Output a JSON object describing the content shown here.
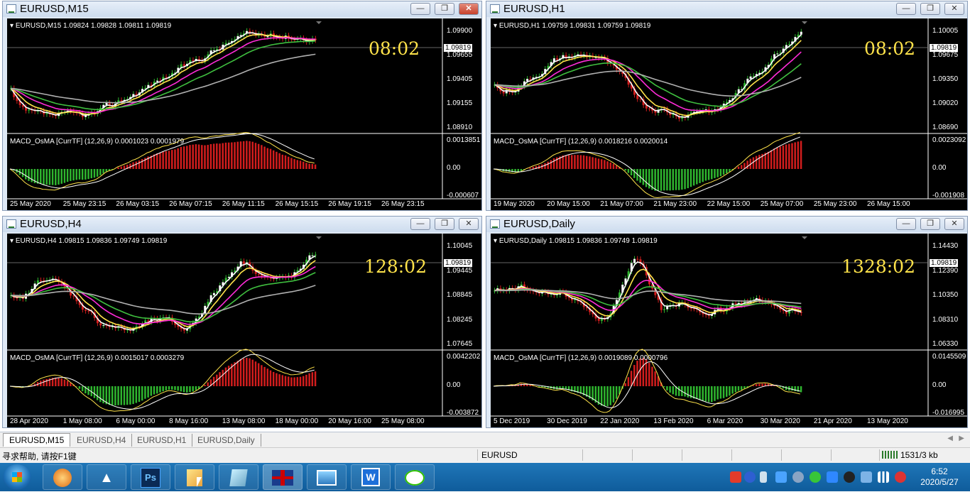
{
  "windows": [
    {
      "title": "EURUSD,M15",
      "info": "EURUSD,M15  1.09824 1.09828 1.09811 1.09819",
      "clock": "08:02",
      "price_label": "1.09819",
      "price_ticks": [
        "1.09900",
        "1.09655",
        "1.09405",
        "1.09155",
        "1.08910"
      ],
      "macd_info": "MACD_OsMA [CurrTF] (12,26,9) 0.0001023 0.0001979",
      "macd_ticks": [
        "0.0013851",
        "0.00",
        "-0.000607"
      ],
      "time_ticks": [
        "25 May 2020",
        "25 May 23:15",
        "26 May 03:15",
        "26 May 07:15",
        "26 May 11:15",
        "26 May 15:15",
        "26 May 19:15",
        "26 May 23:15"
      ]
    },
    {
      "title": "EURUSD,H1",
      "info": "EURUSD,H1  1.09759 1.09831 1.09759 1.09819",
      "clock": "08:02",
      "price_label": "1.09819",
      "price_ticks": [
        "1.10005",
        "1.09675",
        "1.09350",
        "1.09020",
        "1.08690"
      ],
      "macd_info": "MACD_OsMA [CurrTF] (12,26,9) 0.0018216 0.0020014",
      "macd_ticks": [
        "0.0023092",
        "0.00",
        "-0.001908"
      ],
      "time_ticks": [
        "19 May 2020",
        "20 May 15:00",
        "21 May 07:00",
        "21 May 23:00",
        "22 May 15:00",
        "25 May 07:00",
        "25 May 23:00",
        "26 May 15:00"
      ]
    },
    {
      "title": "EURUSD,H4",
      "info": "EURUSD,H4  1.09815 1.09836 1.09749 1.09819",
      "clock": "128:02",
      "price_label": "1.09819",
      "price_ticks": [
        "1.10045",
        "1.09445",
        "1.08845",
        "1.08245",
        "1.07645"
      ],
      "macd_info": "MACD_OsMA [CurrTF] (12,26,9) 0.0015017 0.0003279",
      "macd_ticks": [
        "0.0042202",
        "0.00",
        "-0.003872"
      ],
      "time_ticks": [
        "28 Apr 2020",
        "1 May 08:00",
        "6 May 00:00",
        "8 May 16:00",
        "13 May 08:00",
        "18 May 00:00",
        "20 May 16:00",
        "25 May 08:00"
      ]
    },
    {
      "title": "EURUSD,Daily",
      "info": "EURUSD,Daily  1.09815 1.09836 1.09749 1.09819",
      "clock": "1328:02",
      "price_label": "1.09819",
      "price_ticks": [
        "1.14430",
        "1.12390",
        "1.10350",
        "1.08310",
        "1.06330"
      ],
      "macd_info": "MACD_OsMA [CurrTF] (12,26,9) 0.0019089 0.0000796",
      "macd_ticks": [
        "0.0145509",
        "0.00",
        "-0.016995"
      ],
      "time_ticks": [
        "5 Dec 2019",
        "30 Dec 2019",
        "22 Jan 2020",
        "13 Feb 2020",
        "6 Mar 2020",
        "30 Mar 2020",
        "21 Apr 2020",
        "13 May 2020"
      ]
    }
  ],
  "window_buttons": {
    "minimize": "—",
    "restore": "❐",
    "close": "✕"
  },
  "tabs": [
    "EURUSD,M15",
    "EURUSD,H4",
    "EURUSD,H1",
    "EURUSD,Daily"
  ],
  "status": {
    "help": "寻求帮助, 请按F1键",
    "symbol": "EURUSD",
    "traffic": "1531/3 kb"
  },
  "taskbar": {
    "apps": [
      "start",
      "browser",
      "feishu",
      "Ps",
      "paint",
      "notepad",
      "uk-flag",
      "photos",
      "wps",
      "wechat"
    ],
    "time": "6:52",
    "date": "2020/5/27"
  },
  "colors": {
    "ma_fast": "#ffffff",
    "ma_mid": "#ffe34a",
    "ma_slow": "#ff2bd8",
    "ma_green": "#3fbf3f",
    "ma_grey": "#b0b0b0",
    "bull": "#2fb62f",
    "bear": "#d21d1d"
  }
}
